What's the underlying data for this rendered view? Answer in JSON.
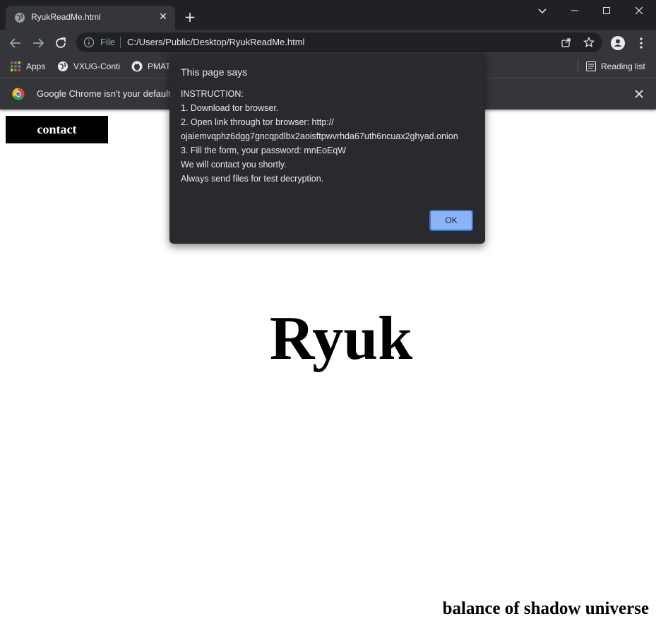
{
  "browser": {
    "tab_title": "RyukReadMe.html",
    "new_tab_symbol": "+",
    "address": {
      "scheme_label": "File",
      "url": "C:/Users/Public/Desktop/RyukReadMe.html"
    },
    "bookmarks": [
      {
        "label": "Apps",
        "icon": "apps-grid-icon"
      },
      {
        "label": "VXUG-Conti",
        "icon": "globe-icon"
      },
      {
        "label": "PMAT",
        "icon": "github-icon"
      }
    ],
    "reading_list_label": "Reading list",
    "infobar_text": "Google Chrome isn't your default"
  },
  "page": {
    "contact_label": "contact",
    "heading": "Ryuk",
    "footer": "balance of shadow universe"
  },
  "dialog": {
    "title": "This page says",
    "lines": [
      "INSTRUCTION:",
      "1. Download tor browser.",
      "2. Open link through tor browser: http://",
      "ojaiemvqphz6dgg7gncqpdlbx2aoisftpwvrhda67uth6ncuax2ghyad.onion",
      "3. Fill the form, your password: mnEoEqW",
      "We will contact you shortly.",
      "Always send files for test decryption."
    ],
    "ok_label": "OK"
  },
  "colors": {
    "chrome_dark": "#202124",
    "chrome_mid": "#35363a",
    "dialog_bg": "#292a2d",
    "ok_button": "#8ab4f8"
  }
}
